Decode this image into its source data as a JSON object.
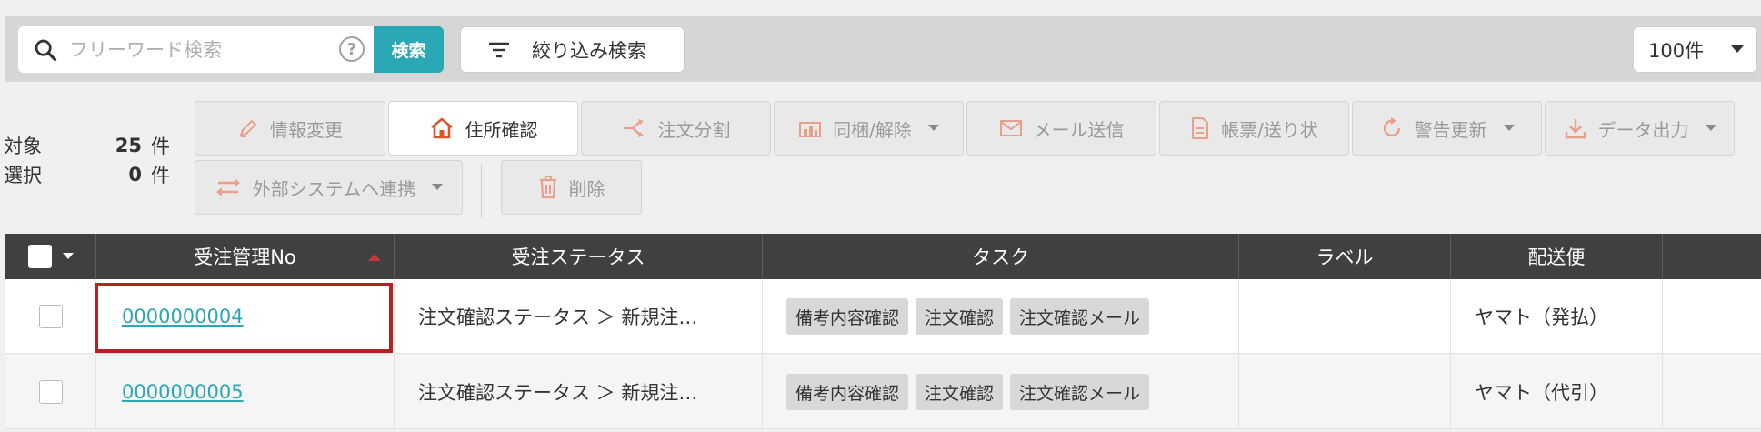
{
  "search": {
    "placeholder": "フリーワード検索",
    "help": "?",
    "button_label": "検索"
  },
  "filter": {
    "label": "絞り込み検索"
  },
  "per_page": {
    "value": "100件"
  },
  "counts": {
    "target_label": "対象",
    "target_value": "25",
    "target_unit": "件",
    "selected_label": "選択",
    "selected_value": "0",
    "selected_unit": "件"
  },
  "toolbar": {
    "info_change": "情報変更",
    "address_check": "住所確認",
    "order_split": "注文分割",
    "bundle": "同梱/解除",
    "mail_send": "メール送信",
    "forms": "帳票/送り状",
    "warning_update": "警告更新",
    "data_export": "データ出力",
    "external_link": "外部システムへ連携",
    "delete": "削除"
  },
  "colors": {
    "accent": "#2aa8b5",
    "header_bg": "#404040",
    "highlight": "#b42222"
  },
  "table": {
    "headers": [
      "受注管理No",
      "受注ステータス",
      "タスク",
      "ラベル",
      "配送便"
    ],
    "rows": [
      {
        "order_no": "0000000004",
        "status": "注文確認ステータス ＞ 新規注…",
        "tasks": [
          "備考内容確認",
          "注文確認",
          "注文確認メール"
        ],
        "label": "",
        "carrier": "ヤマト（発払）"
      },
      {
        "order_no": "0000000005",
        "status": "注文確認ステータス ＞ 新規注…",
        "tasks": [
          "備考内容確認",
          "注文確認",
          "注文確認メール"
        ],
        "label": "",
        "carrier": "ヤマト（代引）"
      }
    ]
  }
}
